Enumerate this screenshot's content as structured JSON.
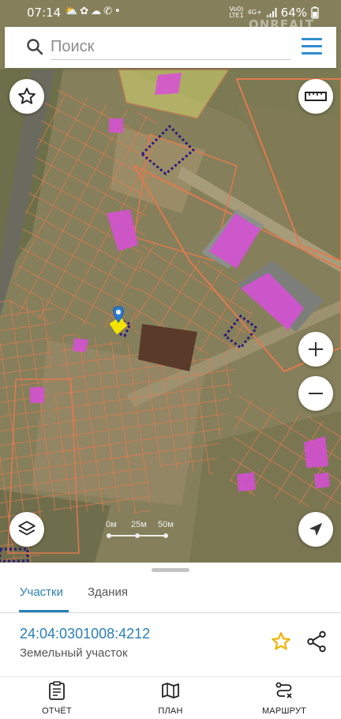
{
  "status_bar": {
    "time": "07:14",
    "left_icons": [
      "cloud-sun-icon",
      "flower-icon",
      "cloud-icon",
      "whatsapp-icon",
      "dot-icon"
    ],
    "volte_label_1": "Vo0)",
    "volte_label_2": "LTE1",
    "network": "4G+",
    "battery": "64%"
  },
  "watermark": "ONREALT",
  "search": {
    "placeholder": "Поиск",
    "icon": "search-icon",
    "menu_icon": "hamburger-menu-icon"
  },
  "map": {
    "buttons": [
      "favorites-star-icon",
      "ruler-icon",
      "zoom-in-icon",
      "zoom-out-icon",
      "layers-icon",
      "navigation-arrow-icon"
    ],
    "scale_labels": [
      "0м",
      "25м",
      "50м"
    ],
    "colors": {
      "parcel": "#e07a4f",
      "building": "#d84fd8",
      "selected": "#f2e400",
      "dotted": "#2a1b7c"
    }
  },
  "sheet": {
    "tabs": [
      {
        "label": "Участки",
        "active": true
      },
      {
        "label": "Здания",
        "active": false
      }
    ],
    "cadastral_number": "24:04:0301008:4212",
    "parcel_type": "Земельный участок",
    "favorite_icon": "star-outline-icon",
    "share_icon": "share-icon",
    "accent_color": "#2a7fb8",
    "star_color": "#f0b400"
  },
  "bottom_nav": [
    {
      "label": "ОТЧЁТ",
      "icon": "report-clipboard-icon"
    },
    {
      "label": "ПЛАН",
      "icon": "map-plan-icon"
    },
    {
      "label": "МАРШРУТ",
      "icon": "route-icon"
    }
  ]
}
